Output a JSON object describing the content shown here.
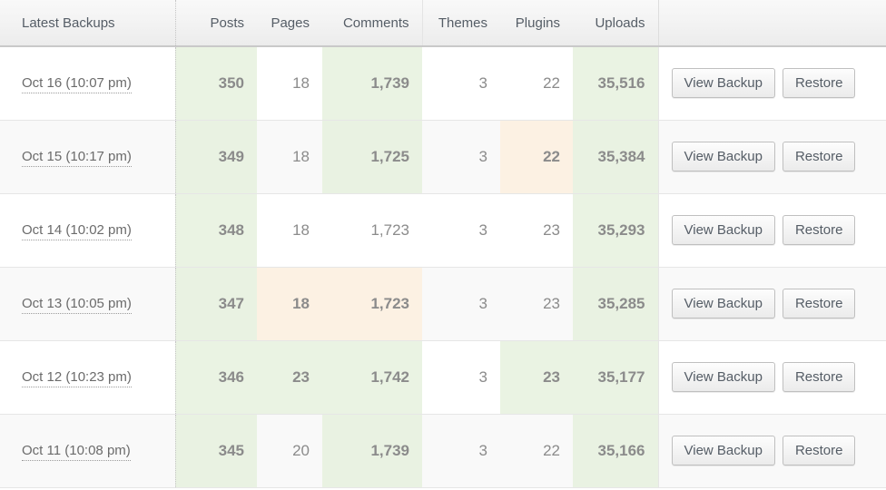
{
  "table": {
    "columns": [
      {
        "key": "date",
        "label": "Latest Backups"
      },
      {
        "key": "posts",
        "label": "Posts"
      },
      {
        "key": "pages",
        "label": "Pages"
      },
      {
        "key": "comments",
        "label": "Comments"
      },
      {
        "key": "themes",
        "label": "Themes"
      },
      {
        "key": "plugins",
        "label": "Plugins"
      },
      {
        "key": "uploads",
        "label": "Uploads"
      },
      {
        "key": "actions",
        "label": ""
      }
    ],
    "actions": {
      "view_label": "View Backup",
      "restore_label": "Restore"
    },
    "colors": {
      "up": "#5fa832",
      "warn": "#efa02e",
      "flat": "#8b8b8b",
      "up_bg": "#eaf3e3",
      "warn_bg": "#fdf2e4"
    },
    "rows": [
      {
        "date": "Oct 16 (10:07 pm)",
        "posts": {
          "value": "350",
          "state": "up"
        },
        "pages": {
          "value": "18",
          "state": "flat"
        },
        "comments": {
          "value": "1,739",
          "state": "up"
        },
        "themes": {
          "value": "3",
          "state": "flat"
        },
        "plugins": {
          "value": "22",
          "state": "flat"
        },
        "uploads": {
          "value": "35,516",
          "state": "up"
        }
      },
      {
        "date": "Oct 15 (10:17 pm)",
        "posts": {
          "value": "349",
          "state": "up"
        },
        "pages": {
          "value": "18",
          "state": "flat"
        },
        "comments": {
          "value": "1,725",
          "state": "up"
        },
        "themes": {
          "value": "3",
          "state": "flat"
        },
        "plugins": {
          "value": "22",
          "state": "warn"
        },
        "uploads": {
          "value": "35,384",
          "state": "up"
        }
      },
      {
        "date": "Oct 14 (10:02 pm)",
        "posts": {
          "value": "348",
          "state": "up"
        },
        "pages": {
          "value": "18",
          "state": "flat"
        },
        "comments": {
          "value": "1,723",
          "state": "flat"
        },
        "themes": {
          "value": "3",
          "state": "flat"
        },
        "plugins": {
          "value": "23",
          "state": "flat"
        },
        "uploads": {
          "value": "35,293",
          "state": "up"
        }
      },
      {
        "date": "Oct 13 (10:05 pm)",
        "posts": {
          "value": "347",
          "state": "up"
        },
        "pages": {
          "value": "18",
          "state": "warn"
        },
        "comments": {
          "value": "1,723",
          "state": "warn"
        },
        "themes": {
          "value": "3",
          "state": "flat"
        },
        "plugins": {
          "value": "23",
          "state": "flat"
        },
        "uploads": {
          "value": "35,285",
          "state": "up"
        }
      },
      {
        "date": "Oct 12 (10:23 pm)",
        "posts": {
          "value": "346",
          "state": "up"
        },
        "pages": {
          "value": "23",
          "state": "up"
        },
        "comments": {
          "value": "1,742",
          "state": "up"
        },
        "themes": {
          "value": "3",
          "state": "flat"
        },
        "plugins": {
          "value": "23",
          "state": "up"
        },
        "uploads": {
          "value": "35,177",
          "state": "up"
        }
      },
      {
        "date": "Oct 11 (10:08 pm)",
        "posts": {
          "value": "345",
          "state": "up"
        },
        "pages": {
          "value": "20",
          "state": "flat"
        },
        "comments": {
          "value": "1,739",
          "state": "up"
        },
        "themes": {
          "value": "3",
          "state": "flat"
        },
        "plugins": {
          "value": "22",
          "state": "flat"
        },
        "uploads": {
          "value": "35,166",
          "state": "up"
        }
      }
    ]
  }
}
